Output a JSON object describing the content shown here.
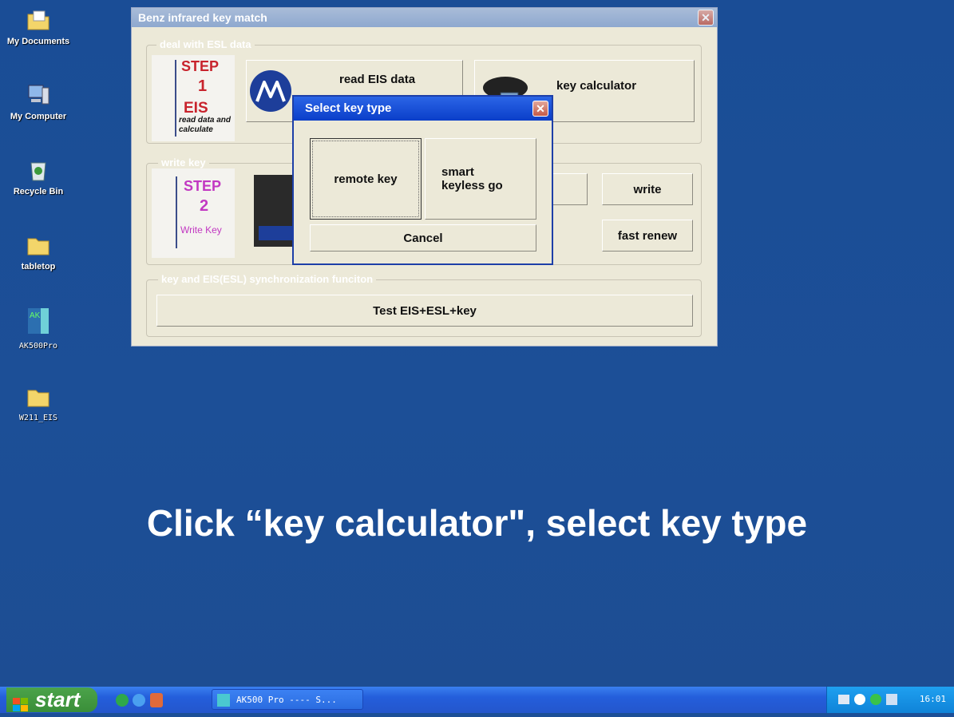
{
  "desktop": {
    "icons": [
      {
        "label": "My Documents"
      },
      {
        "label": "My Computer"
      },
      {
        "label": "Recycle Bin"
      },
      {
        "label": "tabletop"
      },
      {
        "label": "AK500Pro"
      },
      {
        "label": "W211_EIS"
      }
    ]
  },
  "main_window": {
    "title": "Benz infrared key match",
    "close_symbol": "✕",
    "esl_group": {
      "legend": "deal with ESL data",
      "step_word": "STEP",
      "step_num": "1",
      "step_name": "EIS",
      "step_desc": "read data and calculate",
      "read_eis_label": "read EIS data",
      "key_calculator_label": "key calculator"
    },
    "write_group": {
      "legend": "write key",
      "step_word": "STEP",
      "step_num": "2",
      "step_name": "Write Key",
      "write_label": "write",
      "fast_renew_label": "fast renew"
    },
    "sync_group": {
      "legend": "key and EIS(ESL) synchronization funciton",
      "test_label": "Test EIS+ESL+key"
    }
  },
  "dialog": {
    "title": "Select key type",
    "close_symbol": "✕",
    "remote_key_label": "remote key",
    "smart_key_label_1": "smart",
    "smart_key_label_2": "keyless go",
    "cancel_label": "Cancel"
  },
  "caption": "Click “key calculator\", select key type",
  "taskbar": {
    "start_label": "start",
    "task_label": "AK500 Pro ---- S...",
    "clock": "16:01"
  },
  "colors": {
    "desktop_bg": "#1c4f97",
    "step1_color": "#c8232c",
    "step2_color": "#c238c2",
    "dialog_title_bg": "#0a3ec9"
  }
}
